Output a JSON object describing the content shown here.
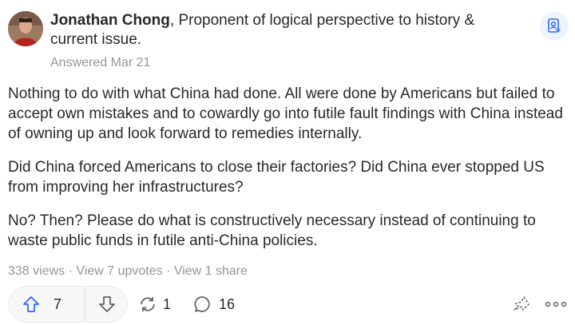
{
  "author": {
    "name": "Jonathan Chong",
    "credential": ", Proponent of logical perspective to history & current issue.",
    "answered": "Answered Mar 21"
  },
  "answer": {
    "paragraphs": [
      "Nothing to do with what China had done. All were done by Americans but failed to accept own mistakes and to cowardly go into futile fault findings with China instead of owning up and look forward to remedies internally.",
      "Did China forced Americans to close their factories? Did China ever stopped US from improving her infrastructures?",
      "No? Then? Please do what is constructively necessary instead of continuing to waste public funds in futile anti-China policies."
    ]
  },
  "stats": {
    "views": "338 views",
    "upvotes": "View 7 upvotes",
    "shares": "View 1 share",
    "separator": " · "
  },
  "actions": {
    "upvote_count": "7",
    "share_count": "1",
    "comment_count": "16"
  },
  "icons": {
    "follow": "person-add-icon",
    "upvote": "arrow-up-icon",
    "downvote": "arrow-down-icon",
    "share": "reshare-icon",
    "comment": "comment-bubble-icon",
    "forward": "share-forward-icon",
    "more": "more-dots-icon"
  },
  "colors": {
    "upvote_blue": "#2e69ff",
    "text": "#282829",
    "muted": "#939598",
    "pill_bg": "#f7f7f8"
  }
}
